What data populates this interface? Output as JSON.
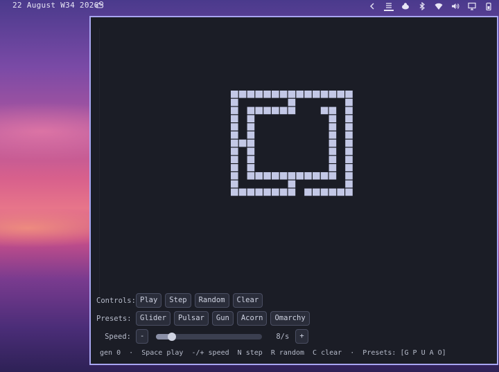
{
  "topbar": {
    "clock": "22 August W34 2026",
    "weather_icon": "cloud-sun-icon",
    "tray_icons": [
      "chevron-left-icon",
      "workspace-icon",
      "blob-icon",
      "bluetooth-icon",
      "wifi-icon",
      "volume-icon",
      "display-icon",
      "battery-icon"
    ]
  },
  "board": {
    "cell_color": "#c3c8e6",
    "alive_cells": [
      [
        0,
        0
      ],
      [
        0,
        1
      ],
      [
        0,
        2
      ],
      [
        0,
        3
      ],
      [
        0,
        4
      ],
      [
        0,
        5
      ],
      [
        0,
        6
      ],
      [
        0,
        7
      ],
      [
        0,
        8
      ],
      [
        0,
        9
      ],
      [
        0,
        10
      ],
      [
        0,
        11
      ],
      [
        0,
        12
      ],
      [
        0,
        13
      ],
      [
        0,
        14
      ],
      [
        1,
        0
      ],
      [
        1,
        7
      ],
      [
        1,
        14
      ],
      [
        2,
        0
      ],
      [
        2,
        2
      ],
      [
        2,
        3
      ],
      [
        2,
        4
      ],
      [
        2,
        5
      ],
      [
        2,
        6
      ],
      [
        2,
        7
      ],
      [
        2,
        11
      ],
      [
        2,
        12
      ],
      [
        2,
        14
      ],
      [
        3,
        0
      ],
      [
        3,
        2
      ],
      [
        3,
        12
      ],
      [
        3,
        14
      ],
      [
        4,
        0
      ],
      [
        4,
        2
      ],
      [
        4,
        12
      ],
      [
        4,
        14
      ],
      [
        5,
        0
      ],
      [
        5,
        2
      ],
      [
        5,
        12
      ],
      [
        5,
        14
      ],
      [
        6,
        0
      ],
      [
        6,
        1
      ],
      [
        6,
        2
      ],
      [
        6,
        12
      ],
      [
        6,
        14
      ],
      [
        7,
        0
      ],
      [
        7,
        2
      ],
      [
        7,
        12
      ],
      [
        7,
        14
      ],
      [
        8,
        0
      ],
      [
        8,
        2
      ],
      [
        8,
        12
      ],
      [
        8,
        14
      ],
      [
        9,
        0
      ],
      [
        9,
        2
      ],
      [
        9,
        12
      ],
      [
        9,
        14
      ],
      [
        10,
        0
      ],
      [
        10,
        2
      ],
      [
        10,
        3
      ],
      [
        10,
        4
      ],
      [
        10,
        5
      ],
      [
        10,
        6
      ],
      [
        10,
        7
      ],
      [
        10,
        8
      ],
      [
        10,
        9
      ],
      [
        10,
        10
      ],
      [
        10,
        11
      ],
      [
        10,
        12
      ],
      [
        10,
        14
      ],
      [
        11,
        0
      ],
      [
        11,
        7
      ],
      [
        11,
        14
      ],
      [
        12,
        0
      ],
      [
        12,
        1
      ],
      [
        12,
        2
      ],
      [
        12,
        3
      ],
      [
        12,
        4
      ],
      [
        12,
        5
      ],
      [
        12,
        6
      ],
      [
        12,
        7
      ],
      [
        12,
        9
      ],
      [
        12,
        10
      ],
      [
        12,
        11
      ],
      [
        12,
        12
      ],
      [
        12,
        13
      ],
      [
        12,
        14
      ]
    ]
  },
  "controls": {
    "label": "Controls:",
    "buttons": [
      "Play",
      "Step",
      "Random",
      "Clear"
    ]
  },
  "presets": {
    "label": "Presets:",
    "buttons": [
      "Glider",
      "Pulsar",
      "Gun",
      "Acorn",
      "Omarchy"
    ]
  },
  "speed": {
    "label": "Speed:",
    "minus": "-",
    "plus": "+",
    "value_text": "8/s",
    "level": 0.12
  },
  "status": {
    "text": "gen 0  ·  Space play  -/+ speed  N step  R random  C clear  ·  Presets: [G P U A O]"
  }
}
